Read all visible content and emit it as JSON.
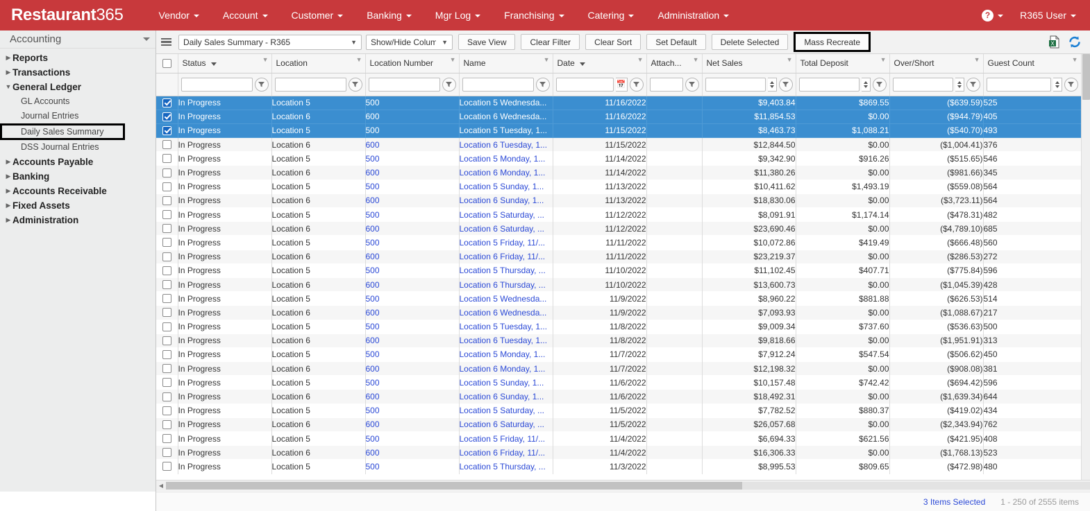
{
  "topnav": {
    "brand_bold": "Restaurant",
    "brand_light": "365",
    "items": [
      {
        "label": "Vendor"
      },
      {
        "label": "Account"
      },
      {
        "label": "Customer"
      },
      {
        "label": "Banking"
      },
      {
        "label": "Mgr Log"
      },
      {
        "label": "Franchising"
      },
      {
        "label": "Catering"
      },
      {
        "label": "Administration"
      }
    ],
    "help_glyph": "?",
    "user_label": "R365 User",
    "bar_color": "#c8393c"
  },
  "sidebar": {
    "title": "Accounting",
    "nodes": [
      {
        "label": "Reports",
        "expanded": false
      },
      {
        "label": "Transactions",
        "expanded": false
      },
      {
        "label": "General Ledger",
        "expanded": true,
        "children": [
          "GL Accounts",
          "Journal Entries",
          "Daily Sales Summary",
          "DSS Journal Entries"
        ],
        "highlighted_child": "Daily Sales Summary"
      },
      {
        "label": "Accounts Payable",
        "expanded": false
      },
      {
        "label": "Banking",
        "expanded": false
      },
      {
        "label": "Accounts Receivable",
        "expanded": false
      },
      {
        "label": "Fixed Assets",
        "expanded": false
      },
      {
        "label": "Administration",
        "expanded": false
      }
    ]
  },
  "toolbar": {
    "view_select_value": "Daily Sales Summary - R365",
    "columns_select_value": "Show/Hide Columns",
    "save_view_label": "Save View",
    "clear_filter_label": "Clear Filter",
    "clear_sort_label": "Clear Sort",
    "set_default_label": "Set Default",
    "delete_selected_label": "Delete Selected",
    "mass_recreate_label": "Mass Recreate",
    "mass_recreate_highlighted": true
  },
  "grid": {
    "columns": [
      {
        "key": "check",
        "label": "",
        "sortable": false
      },
      {
        "key": "status",
        "label": "Status",
        "sorted": true
      },
      {
        "key": "loc",
        "label": "Location"
      },
      {
        "key": "locnum",
        "label": "Location Number"
      },
      {
        "key": "name",
        "label": "Name"
      },
      {
        "key": "date",
        "label": "Date",
        "sorted": true
      },
      {
        "key": "attach",
        "label": "Attach..."
      },
      {
        "key": "netsales",
        "label": "Net Sales"
      },
      {
        "key": "deposit",
        "label": "Total Deposit"
      },
      {
        "key": "overshort",
        "label": "Over/Short"
      },
      {
        "key": "guests",
        "label": "Guest Count"
      }
    ],
    "filter_values": {
      "status": "",
      "loc": "",
      "locnum": "",
      "name": "",
      "date": "",
      "attach": "",
      "netsales": "",
      "deposit": "",
      "overshort": "",
      "guests": ""
    },
    "rows": [
      {
        "selected": true,
        "status": "In Progress",
        "loc": "Location 5",
        "locnum": "500",
        "name": "Location 5 Wednesda...",
        "date": "11/16/2022",
        "attach": "",
        "netsales": "$9,403.84",
        "deposit": "$869.55",
        "overshort": "($639.59)",
        "guests": "525"
      },
      {
        "selected": true,
        "status": "In Progress",
        "loc": "Location 6",
        "locnum": "600",
        "name": "Location 6 Wednesda...",
        "date": "11/16/2022",
        "attach": "",
        "netsales": "$11,854.53",
        "deposit": "$0.00",
        "overshort": "($944.79)",
        "guests": "405"
      },
      {
        "selected": true,
        "status": "In Progress",
        "loc": "Location 5",
        "locnum": "500",
        "name": "Location 5 Tuesday, 1...",
        "date": "11/15/2022",
        "attach": "",
        "netsales": "$8,463.73",
        "deposit": "$1,088.21",
        "overshort": "($540.70)",
        "guests": "493"
      },
      {
        "selected": false,
        "status": "In Progress",
        "loc": "Location 6",
        "locnum": "600",
        "name": "Location 6 Tuesday, 1...",
        "date": "11/15/2022",
        "attach": "",
        "netsales": "$12,844.50",
        "deposit": "$0.00",
        "overshort": "($1,004.41)",
        "guests": "376"
      },
      {
        "selected": false,
        "status": "In Progress",
        "loc": "Location 5",
        "locnum": "500",
        "name": "Location 5 Monday, 1...",
        "date": "11/14/2022",
        "attach": "",
        "netsales": "$9,342.90",
        "deposit": "$916.26",
        "overshort": "($515.65)",
        "guests": "546"
      },
      {
        "selected": false,
        "status": "In Progress",
        "loc": "Location 6",
        "locnum": "600",
        "name": "Location 6 Monday, 1...",
        "date": "11/14/2022",
        "attach": "",
        "netsales": "$11,380.26",
        "deposit": "$0.00",
        "overshort": "($981.66)",
        "guests": "345"
      },
      {
        "selected": false,
        "status": "In Progress",
        "loc": "Location 5",
        "locnum": "500",
        "name": "Location 5 Sunday, 1...",
        "date": "11/13/2022",
        "attach": "",
        "netsales": "$10,411.62",
        "deposit": "$1,493.19",
        "overshort": "($559.08)",
        "guests": "564"
      },
      {
        "selected": false,
        "status": "In Progress",
        "loc": "Location 6",
        "locnum": "600",
        "name": "Location 6 Sunday, 1...",
        "date": "11/13/2022",
        "attach": "",
        "netsales": "$18,830.06",
        "deposit": "$0.00",
        "overshort": "($3,723.11)",
        "guests": "564"
      },
      {
        "selected": false,
        "status": "In Progress",
        "loc": "Location 5",
        "locnum": "500",
        "name": "Location 5 Saturday, ...",
        "date": "11/12/2022",
        "attach": "",
        "netsales": "$8,091.91",
        "deposit": "$1,174.14",
        "overshort": "($478.31)",
        "guests": "482"
      },
      {
        "selected": false,
        "status": "In Progress",
        "loc": "Location 6",
        "locnum": "600",
        "name": "Location 6 Saturday, ...",
        "date": "11/12/2022",
        "attach": "",
        "netsales": "$23,690.46",
        "deposit": "$0.00",
        "overshort": "($4,789.10)",
        "guests": "685"
      },
      {
        "selected": false,
        "status": "In Progress",
        "loc": "Location 5",
        "locnum": "500",
        "name": "Location 5 Friday, 11/...",
        "date": "11/11/2022",
        "attach": "",
        "netsales": "$10,072.86",
        "deposit": "$419.49",
        "overshort": "($666.48)",
        "guests": "560"
      },
      {
        "selected": false,
        "status": "In Progress",
        "loc": "Location 6",
        "locnum": "600",
        "name": "Location 6 Friday, 11/...",
        "date": "11/11/2022",
        "attach": "",
        "netsales": "$23,219.37",
        "deposit": "$0.00",
        "overshort": "($286.53)",
        "guests": "272"
      },
      {
        "selected": false,
        "status": "In Progress",
        "loc": "Location 5",
        "locnum": "500",
        "name": "Location 5 Thursday, ...",
        "date": "11/10/2022",
        "attach": "",
        "netsales": "$11,102.45",
        "deposit": "$407.71",
        "overshort": "($775.84)",
        "guests": "596"
      },
      {
        "selected": false,
        "status": "In Progress",
        "loc": "Location 6",
        "locnum": "600",
        "name": "Location 6 Thursday, ...",
        "date": "11/10/2022",
        "attach": "",
        "netsales": "$13,600.73",
        "deposit": "$0.00",
        "overshort": "($1,045.39)",
        "guests": "428"
      },
      {
        "selected": false,
        "status": "In Progress",
        "loc": "Location 5",
        "locnum": "500",
        "name": "Location 5 Wednesda...",
        "date": "11/9/2022",
        "attach": "",
        "netsales": "$8,960.22",
        "deposit": "$881.88",
        "overshort": "($626.53)",
        "guests": "514"
      },
      {
        "selected": false,
        "status": "In Progress",
        "loc": "Location 6",
        "locnum": "600",
        "name": "Location 6 Wednesda...",
        "date": "11/9/2022",
        "attach": "",
        "netsales": "$7,093.93",
        "deposit": "$0.00",
        "overshort": "($1,088.67)",
        "guests": "217"
      },
      {
        "selected": false,
        "status": "In Progress",
        "loc": "Location 5",
        "locnum": "500",
        "name": "Location 5 Tuesday, 1...",
        "date": "11/8/2022",
        "attach": "",
        "netsales": "$9,009.34",
        "deposit": "$737.60",
        "overshort": "($536.63)",
        "guests": "500"
      },
      {
        "selected": false,
        "status": "In Progress",
        "loc": "Location 6",
        "locnum": "600",
        "name": "Location 6 Tuesday, 1...",
        "date": "11/8/2022",
        "attach": "",
        "netsales": "$9,818.66",
        "deposit": "$0.00",
        "overshort": "($1,951.91)",
        "guests": "313"
      },
      {
        "selected": false,
        "status": "In Progress",
        "loc": "Location 5",
        "locnum": "500",
        "name": "Location 5 Monday, 1...",
        "date": "11/7/2022",
        "attach": "",
        "netsales": "$7,912.24",
        "deposit": "$547.54",
        "overshort": "($506.62)",
        "guests": "450"
      },
      {
        "selected": false,
        "status": "In Progress",
        "loc": "Location 6",
        "locnum": "600",
        "name": "Location 6 Monday, 1...",
        "date": "11/7/2022",
        "attach": "",
        "netsales": "$12,198.32",
        "deposit": "$0.00",
        "overshort": "($908.08)",
        "guests": "381"
      },
      {
        "selected": false,
        "status": "In Progress",
        "loc": "Location 5",
        "locnum": "500",
        "name": "Location 5 Sunday, 1...",
        "date": "11/6/2022",
        "attach": "",
        "netsales": "$10,157.48",
        "deposit": "$742.42",
        "overshort": "($694.42)",
        "guests": "596"
      },
      {
        "selected": false,
        "status": "In Progress",
        "loc": "Location 6",
        "locnum": "600",
        "name": "Location 6 Sunday, 1...",
        "date": "11/6/2022",
        "attach": "",
        "netsales": "$18,492.31",
        "deposit": "$0.00",
        "overshort": "($1,639.34)",
        "guests": "644"
      },
      {
        "selected": false,
        "status": "In Progress",
        "loc": "Location 5",
        "locnum": "500",
        "name": "Location 5 Saturday, ...",
        "date": "11/5/2022",
        "attach": "",
        "netsales": "$7,782.52",
        "deposit": "$880.37",
        "overshort": "($419.02)",
        "guests": "434"
      },
      {
        "selected": false,
        "status": "In Progress",
        "loc": "Location 6",
        "locnum": "600",
        "name": "Location 6 Saturday, ...",
        "date": "11/5/2022",
        "attach": "",
        "netsales": "$26,057.68",
        "deposit": "$0.00",
        "overshort": "($2,343.94)",
        "guests": "762"
      },
      {
        "selected": false,
        "status": "In Progress",
        "loc": "Location 5",
        "locnum": "500",
        "name": "Location 5 Friday, 11/...",
        "date": "11/4/2022",
        "attach": "",
        "netsales": "$6,694.33",
        "deposit": "$621.56",
        "overshort": "($421.95)",
        "guests": "408"
      },
      {
        "selected": false,
        "status": "In Progress",
        "loc": "Location 6",
        "locnum": "600",
        "name": "Location 6 Friday, 11/...",
        "date": "11/4/2022",
        "attach": "",
        "netsales": "$16,306.33",
        "deposit": "$0.00",
        "overshort": "($1,768.13)",
        "guests": "523"
      },
      {
        "selected": false,
        "status": "In Progress",
        "loc": "Location 5",
        "locnum": "500",
        "name": "Location 5 Thursday, ...",
        "date": "11/3/2022",
        "attach": "",
        "netsales": "$8,995.53",
        "deposit": "$809.65",
        "overshort": "($472.98)",
        "guests": "480"
      }
    ]
  },
  "statusbar": {
    "selected_text": "3 Items Selected",
    "range_text": "1 - 250 of 2555 items"
  }
}
